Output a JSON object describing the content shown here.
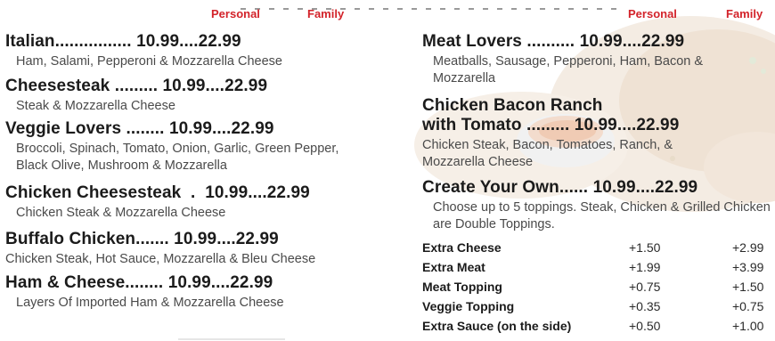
{
  "colors": {
    "accent": "#d3232a",
    "text": "#1b1b1b",
    "muted": "#4a4a4a"
  },
  "left_headers": {
    "personal": "Personal",
    "family": "Family"
  },
  "right_headers": {
    "personal": "Personal",
    "family": "Family"
  },
  "left_items": [
    {
      "name": "Italian",
      "dots": "................",
      "personal": "10.99",
      "sep": "....",
      "family": "22.99",
      "desc": "Ham, Salami, Pepperoni & Mozzarella Cheese"
    },
    {
      "name": "Cheesesteak",
      "dots": ".........",
      "personal": "10.99",
      "sep": "....",
      "family": "22.99",
      "desc": "Steak & Mozzarella Cheese"
    },
    {
      "name": "Veggie Lovers",
      "dots": "........",
      "personal": "10.99",
      "sep": "....",
      "family": "22.99",
      "desc": "Broccoli, Spinach, Tomato, Onion, Garlic, Green Pepper, Black Olive, Mushroom & Mozzarella"
    },
    {
      "name": "Chicken Cheesesteak",
      "dots": ".",
      "personal": "10.99",
      "sep": "....",
      "family": "22.99",
      "desc": "Chicken Steak & Mozzarella Cheese"
    },
    {
      "name": "Buffalo Chicken",
      "dots": ".......",
      "personal": "10.99",
      "sep": "....",
      "family": "22.99",
      "desc": "Chicken Steak, Hot Sauce, Mozzarella & Bleu Cheese"
    },
    {
      "name": "Ham & Cheese",
      "dots": "........",
      "personal": "10.99",
      "sep": "....",
      "family": "22.99",
      "desc": "Layers Of Imported Ham & Mozzarella Cheese"
    }
  ],
  "right_items": [
    {
      "name": "Meat Lovers",
      "dots": "..........",
      "personal": "10.99",
      "sep": "....",
      "family": "22.99",
      "desc": "Meatballs, Sausage, Pepperoni, Ham, Bacon & Mozzarella"
    },
    {
      "name_line1": "Chicken Bacon Ranch",
      "name": "with Tomato",
      "dots": ".........",
      "personal": "10.99",
      "sep": "....",
      "family": "22.99",
      "desc": "Chicken Steak, Bacon, Tomatoes, Ranch, & Mozzarella Cheese"
    },
    {
      "name": "Create Your Own",
      "dots": "......",
      "personal": "10.99",
      "sep": "....",
      "family": "22.99",
      "desc": "Choose up to 5 toppings. Steak, Chicken & Grilled Chicken are Double Toppings."
    }
  ],
  "extras": [
    {
      "name": "Extra Cheese",
      "personal": "+1.50",
      "family": "+2.99"
    },
    {
      "name": "Extra Meat",
      "personal": "+1.99",
      "family": "+3.99"
    },
    {
      "name": "Meat Topping",
      "personal": "+0.75",
      "family": "+1.50"
    },
    {
      "name": "Veggie Topping",
      "personal": "+0.35",
      "family": "+0.75"
    },
    {
      "name": "Extra Sauce (on the side)",
      "personal": "+0.50",
      "family": "+1.00"
    }
  ]
}
